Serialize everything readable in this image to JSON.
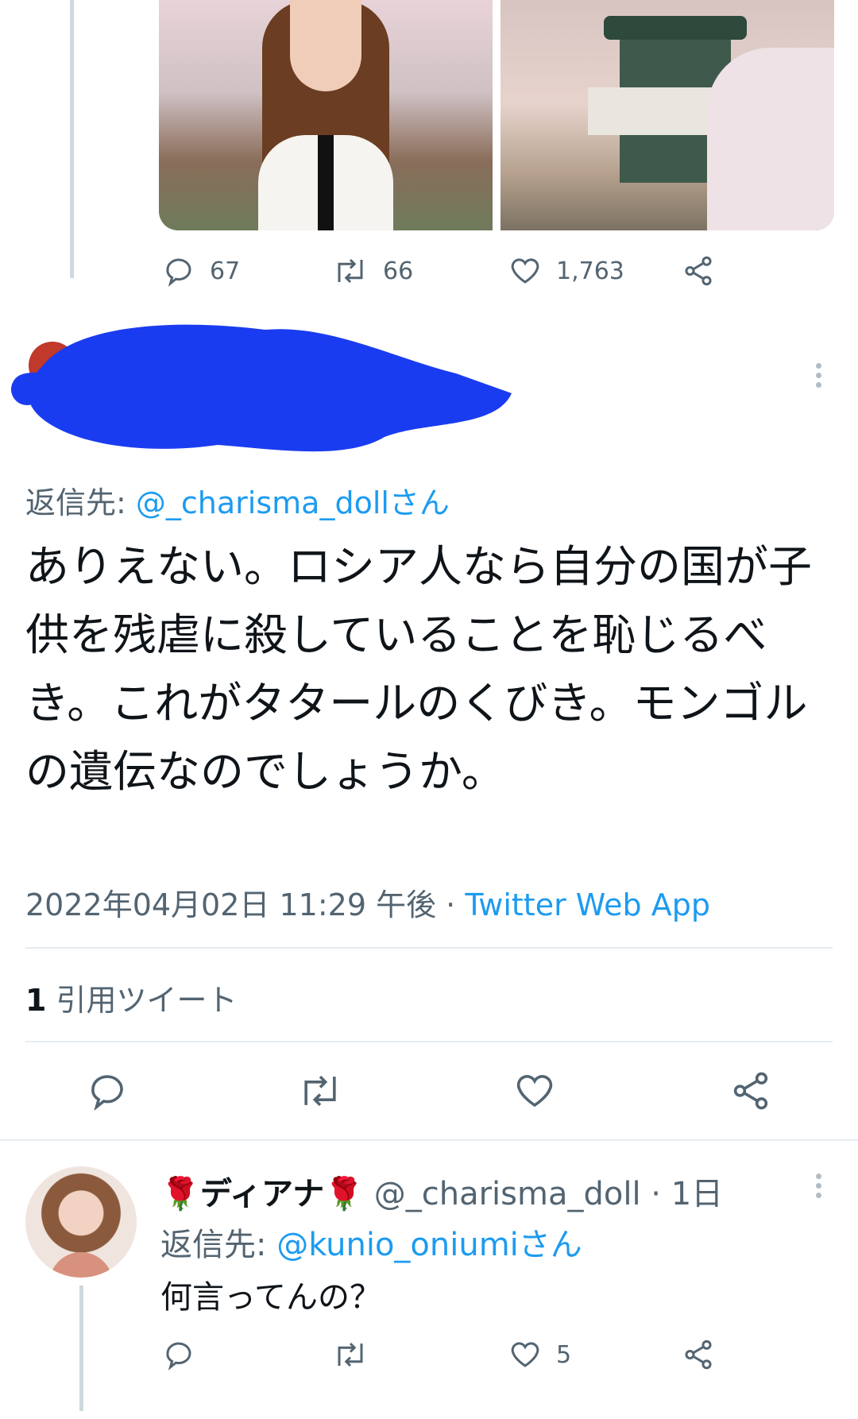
{
  "parent_tweet": {
    "actions": {
      "reply_count": "67",
      "retweet_count": "66",
      "like_count": "1,763"
    }
  },
  "main_tweet": {
    "handle_partial": "@",
    "reply_to_label": "返信先:",
    "reply_to_handle": "@_charisma_dollさん",
    "text": "ありえない。ロシア人なら自分の国が子供を残虐に殺していることを恥じるべき。これがタタールのくびき。モンゴルの遺伝なのでしょうか。",
    "timestamp": "2022年04月02日 11:29 午後",
    "separator": " · ",
    "source": "Twitter Web App",
    "quote_count": "1",
    "quote_label": "引用ツイート"
  },
  "reply_tweet": {
    "display_name": "ディアナ",
    "name_emoji": "🌹",
    "handle": "@_charisma_doll",
    "time": "· 1日",
    "reply_to_label": "返信先:",
    "reply_to_handle": "@kunio_oniumiさん",
    "text": "何言ってんの？",
    "like_count": "5"
  },
  "colors": {
    "accent": "#1d9bf0",
    "muted": "#536471",
    "censor_blue": "#1a3cf0",
    "divider": "#e6ecf0"
  }
}
